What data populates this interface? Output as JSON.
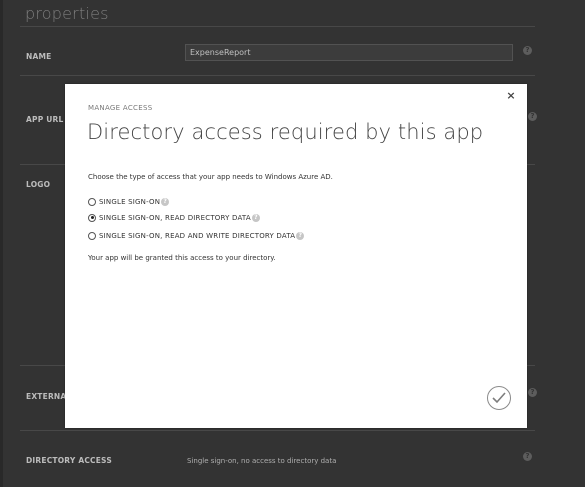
{
  "page": {
    "section_title": "properties",
    "fields": {
      "name_label": "NAME",
      "name_value": "ExpenseReport",
      "app_url_label": "APP URL",
      "logo_label": "LOGO",
      "external_label": "EXTERNAL",
      "directory_access_label": "DIRECTORY ACCESS",
      "directory_access_value": "Single sign-on, no access to directory data"
    },
    "help_glyph": "?"
  },
  "modal": {
    "kicker": "MANAGE ACCESS",
    "title": "Directory access required by this app",
    "description": "Choose the type of access that your app needs to Windows Azure AD.",
    "options": [
      {
        "label": "SINGLE SIGN-ON",
        "checked": false
      },
      {
        "label": "SINGLE SIGN-ON, READ DIRECTORY DATA",
        "checked": true
      },
      {
        "label": "SINGLE SIGN-ON, READ AND WRITE DIRECTORY DATA",
        "checked": false
      }
    ],
    "note": "Your app will be granted this access to your directory.",
    "close_glyph": "×",
    "help_glyph": "?",
    "close_icon": "close-icon",
    "confirm_icon": "checkmark-icon"
  },
  "colors": {
    "page_bg": "#3b3b3b",
    "modal_bg": "#ffffff",
    "text_dark": "#333333"
  }
}
